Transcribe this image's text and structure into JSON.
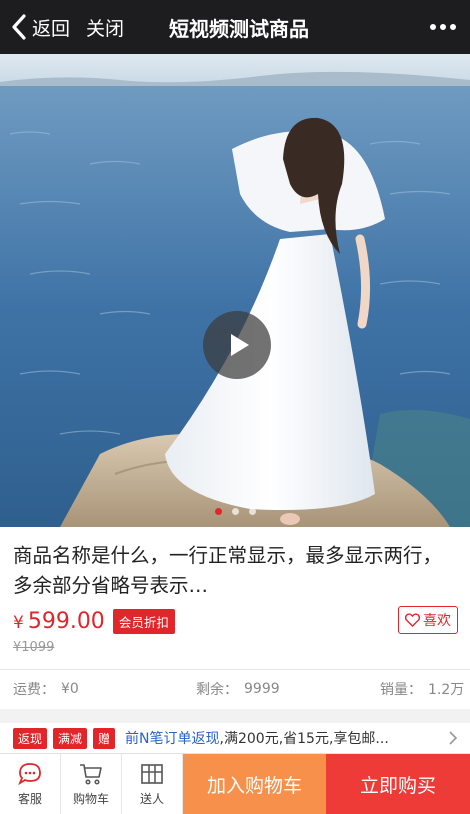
{
  "header": {
    "back_label": "返回",
    "close_label": "关闭",
    "title": "短视频测试商品"
  },
  "media": {
    "slide_count": 3,
    "active_slide": 1
  },
  "product": {
    "name": "商品名称是什么，一行正常显示，最多显示两行，多余部分省略号表示…",
    "currency": "¥",
    "price": "599.00",
    "member_badge": "会员折扣",
    "original_price": "¥1099",
    "like_label": "喜欢"
  },
  "stats": {
    "shipping_label": "运费：",
    "shipping_value": "¥0",
    "stock_label": "剩余：",
    "stock_value": "9999",
    "sales_label": "销量：",
    "sales_value": "1.2万"
  },
  "promo": {
    "tags": [
      "返现",
      "满减",
      "赠"
    ],
    "highlight": "前N笔订单返现",
    "text": ",满200元,省15元,享包邮..."
  },
  "bottom_bar": {
    "service_label": "客服",
    "cart_label": "购物车",
    "gift_label": "送人",
    "add_to_cart_label": "加入购物车",
    "buy_now_label": "立即购买"
  },
  "colors": {
    "accent_red": "#e0262b",
    "add_cart_orange": "#f7904a",
    "buy_now_red": "#ee3b38",
    "header_bg": "#1d1d1f",
    "link_blue": "#2a62c9"
  }
}
